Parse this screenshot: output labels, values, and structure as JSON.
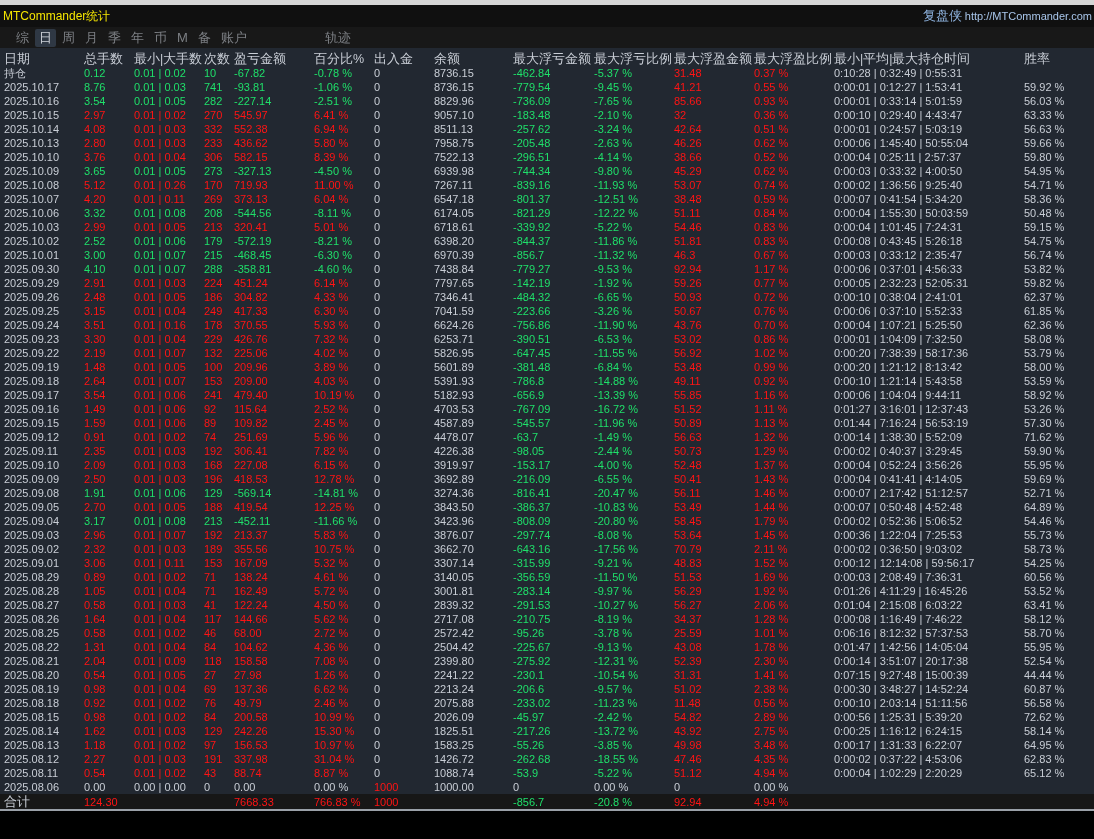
{
  "title": "MTCommander统计",
  "brand": {
    "name": "复盘侠",
    "link": "http://MTCommander.com"
  },
  "tabs": [
    {
      "label": "综",
      "selected": false
    },
    {
      "label": "日",
      "selected": true
    },
    {
      "label": "周",
      "selected": false
    },
    {
      "label": "月",
      "selected": false
    },
    {
      "label": "季",
      "selected": false
    },
    {
      "label": "年",
      "selected": false
    },
    {
      "label": "币",
      "selected": false
    },
    {
      "label": "M",
      "selected": false
    },
    {
      "label": "备",
      "selected": false
    },
    {
      "label": "账户",
      "selected": false
    }
  ],
  "extra_tabs": [
    {
      "label": "轨迹",
      "selected": false
    }
  ],
  "table": {
    "columns": [
      "日期",
      "总手数",
      "最小|大手数",
      "次数",
      "盈亏金额",
      "百分比%",
      "出入金",
      "余额",
      "最大浮亏金额",
      "最大浮亏比例",
      "最大浮盈金额",
      "最大浮盈比例",
      "最小|平均|最大持仓时间",
      "胜率"
    ],
    "rows": [
      {
        "kind": "loss",
        "cells": [
          "持仓",
          "0.12",
          "0.01 | 0.02",
          "10",
          "-67.82",
          "-0.78 %",
          "0",
          "8736.15",
          "-462.84",
          "-5.37 %",
          "31.48",
          "0.37 %",
          "0:10:28 | 0:32:49 | 0:55:31"
        ]
      },
      {
        "kind": "loss",
        "cells": [
          "2025.10.17",
          "8.76",
          "0.01 | 0.03",
          "741",
          "-93.81",
          "-1.06 %",
          "0",
          "8736.15",
          "-779.54",
          "-9.45 %",
          "41.21",
          "0.55 %",
          "0:00:01 | 0:12:27 | 1:53:41",
          "59.92 %"
        ]
      },
      {
        "kind": "loss",
        "cells": [
          "2025.10.16",
          "3.54",
          "0.01 | 0.05",
          "282",
          "-227.14",
          "-2.51 %",
          "0",
          "8829.96",
          "-736.09",
          "-7.65 %",
          "85.66",
          "0.93 %",
          "0:00:01 | 0:33:14 | 5:01:59",
          "56.03 %"
        ]
      },
      {
        "kind": "profit",
        "cells": [
          "2025.10.15",
          "2.97",
          "0.01 | 0.02",
          "270",
          "545.97",
          "6.41 %",
          "0",
          "9057.10",
          "-183.48",
          "-2.10 %",
          "32",
          "0.36 %",
          "0:00:10 | 0:29:40 | 4:43:47",
          "63.33 %"
        ]
      },
      {
        "kind": "profit",
        "cells": [
          "2025.10.14",
          "4.08",
          "0.01 | 0.03",
          "332",
          "552.38",
          "6.94 %",
          "0",
          "8511.13",
          "-257.62",
          "-3.24 %",
          "42.64",
          "0.51 %",
          "0:00:01 | 0:24:57 | 5:03:19",
          "56.63 %"
        ]
      },
      {
        "kind": "profit",
        "cells": [
          "2025.10.13",
          "2.80",
          "0.01 | 0.03",
          "233",
          "436.62",
          "5.80 %",
          "0",
          "7958.75",
          "-205.48",
          "-2.63 %",
          "46.26",
          "0.62 %",
          "0:00:06 | 1:45:40 | 50:55:04",
          "59.66 %"
        ]
      },
      {
        "kind": "profit",
        "cells": [
          "2025.10.10",
          "3.76",
          "0.01 | 0.04",
          "306",
          "582.15",
          "8.39 %",
          "0",
          "7522.13",
          "-296.51",
          "-4.14 %",
          "38.66",
          "0.52 %",
          "0:00:04 | 0:25:11 | 2:57:37",
          "59.80 %"
        ]
      },
      {
        "kind": "loss",
        "cells": [
          "2025.10.09",
          "3.65",
          "0.01 | 0.05",
          "273",
          "-327.13",
          "-4.50 %",
          "0",
          "6939.98",
          "-744.34",
          "-9.80 %",
          "45.29",
          "0.62 %",
          "0:00:03 | 0:33:32 | 4:00:50",
          "54.95 %"
        ]
      },
      {
        "kind": "profit",
        "cells": [
          "2025.10.08",
          "5.12",
          "0.01 | 0.26",
          "170",
          "719.93",
          "11.00 %",
          "0",
          "7267.11",
          "-839.16",
          "-11.93 %",
          "53.07",
          "0.74 %",
          "0:00:02 | 1:36:56 | 9:25:40",
          "54.71 %"
        ]
      },
      {
        "kind": "profit",
        "cells": [
          "2025.10.07",
          "4.20",
          "0.01 | 0.11",
          "269",
          "373.13",
          "6.04 %",
          "0",
          "6547.18",
          "-801.37",
          "-12.51 %",
          "38.48",
          "0.59 %",
          "0:00:07 | 0:41:54 | 5:34:20",
          "58.36 %"
        ]
      },
      {
        "kind": "loss",
        "cells": [
          "2025.10.06",
          "3.32",
          "0.01 | 0.08",
          "208",
          "-544.56",
          "-8.11 %",
          "0",
          "6174.05",
          "-821.29",
          "-12.22 %",
          "51.11",
          "0.84 %",
          "0:00:04 | 1:55:30 | 50:03:59",
          "50.48 %"
        ]
      },
      {
        "kind": "profit",
        "cells": [
          "2025.10.03",
          "2.99",
          "0.01 | 0.05",
          "213",
          "320.41",
          "5.01 %",
          "0",
          "6718.61",
          "-339.92",
          "-5.22 %",
          "54.46",
          "0.83 %",
          "0:00:04 | 1:01:45 | 7:24:31",
          "59.15 %"
        ]
      },
      {
        "kind": "loss",
        "cells": [
          "2025.10.02",
          "2.52",
          "0.01 | 0.06",
          "179",
          "-572.19",
          "-8.21 %",
          "0",
          "6398.20",
          "-844.37",
          "-11.86 %",
          "51.81",
          "0.83 %",
          "0:00:08 | 0:43:45 | 5:26:18",
          "54.75 %"
        ]
      },
      {
        "kind": "loss",
        "cells": [
          "2025.10.01",
          "3.00",
          "0.01 | 0.07",
          "215",
          "-468.45",
          "-6.30 %",
          "0",
          "6970.39",
          "-856.7",
          "-11.32 %",
          "46.3",
          "0.67 %",
          "0:00:03 | 0:33:12 | 2:35:47",
          "56.74 %"
        ]
      },
      {
        "kind": "loss",
        "cells": [
          "2025.09.30",
          "4.10",
          "0.01 | 0.07",
          "288",
          "-358.81",
          "-4.60 %",
          "0",
          "7438.84",
          "-779.27",
          "-9.53 %",
          "92.94",
          "1.17 %",
          "0:00:06 | 0:37:01 | 4:56:33",
          "53.82 %"
        ]
      },
      {
        "kind": "profit",
        "cells": [
          "2025.09.29",
          "2.91",
          "0.01 | 0.03",
          "224",
          "451.24",
          "6.14 %",
          "0",
          "7797.65",
          "-142.19",
          "-1.92 %",
          "59.26",
          "0.77 %",
          "0:00:05 | 2:32:23 | 52:05:31",
          "59.82 %"
        ]
      },
      {
        "kind": "profit",
        "cells": [
          "2025.09.26",
          "2.48",
          "0.01 | 0.05",
          "186",
          "304.82",
          "4.33 %",
          "0",
          "7346.41",
          "-484.32",
          "-6.65 %",
          "50.93",
          "0.72 %",
          "0:00:10 | 0:38:04 | 2:41:01",
          "62.37 %"
        ]
      },
      {
        "kind": "profit",
        "cells": [
          "2025.09.25",
          "3.15",
          "0.01 | 0.04",
          "249",
          "417.33",
          "6.30 %",
          "0",
          "7041.59",
          "-223.66",
          "-3.26 %",
          "50.67",
          "0.76 %",
          "0:00:06 | 0:37:10 | 5:52:33",
          "61.85 %"
        ]
      },
      {
        "kind": "profit",
        "cells": [
          "2025.09.24",
          "3.51",
          "0.01 | 0.16",
          "178",
          "370.55",
          "5.93 %",
          "0",
          "6624.26",
          "-756.86",
          "-11.90 %",
          "43.76",
          "0.70 %",
          "0:00:04 | 1:07:21 | 5:25:50",
          "62.36 %"
        ]
      },
      {
        "kind": "profit",
        "cells": [
          "2025.09.23",
          "3.30",
          "0.01 | 0.04",
          "229",
          "426.76",
          "7.32 %",
          "0",
          "6253.71",
          "-390.51",
          "-6.53 %",
          "53.02",
          "0.86 %",
          "0:00:01 | 1:04:09 | 7:32:50",
          "58.08 %"
        ]
      },
      {
        "kind": "profit",
        "cells": [
          "2025.09.22",
          "2.19",
          "0.01 | 0.07",
          "132",
          "225.06",
          "4.02 %",
          "0",
          "5826.95",
          "-647.45",
          "-11.55 %",
          "56.92",
          "1.02 %",
          "0:00:20 | 7:38:39 | 58:17:36",
          "53.79 %"
        ]
      },
      {
        "kind": "profit",
        "cells": [
          "2025.09.19",
          "1.48",
          "0.01 | 0.05",
          "100",
          "209.96",
          "3.89 %",
          "0",
          "5601.89",
          "-381.48",
          "-6.84 %",
          "53.48",
          "0.99 %",
          "0:00:20 | 1:21:12 | 8:13:42",
          "58.00 %"
        ]
      },
      {
        "kind": "profit",
        "cells": [
          "2025.09.18",
          "2.64",
          "0.01 | 0.07",
          "153",
          "209.00",
          "4.03 %",
          "0",
          "5391.93",
          "-786.8",
          "-14.88 %",
          "49.11",
          "0.92 %",
          "0:00:10 | 1:21:14 | 5:43:58",
          "53.59 %"
        ]
      },
      {
        "kind": "profit",
        "cells": [
          "2025.09.17",
          "3.54",
          "0.01 | 0.06",
          "241",
          "479.40",
          "10.19 %",
          "0",
          "5182.93",
          "-656.9",
          "-13.39 %",
          "55.85",
          "1.16 %",
          "0:00:06 | 1:04:04 | 9:44:11",
          "58.92 %"
        ]
      },
      {
        "kind": "profit",
        "cells": [
          "2025.09.16",
          "1.49",
          "0.01 | 0.06",
          "92",
          "115.64",
          "2.52 %",
          "0",
          "4703.53",
          "-767.09",
          "-16.72 %",
          "51.52",
          "1.11 %",
          "0:01:27 | 3:16:01 | 12:37:43",
          "53.26 %"
        ]
      },
      {
        "kind": "profit",
        "cells": [
          "2025.09.15",
          "1.59",
          "0.01 | 0.06",
          "89",
          "109.82",
          "2.45 %",
          "0",
          "4587.89",
          "-545.57",
          "-11.96 %",
          "50.89",
          "1.13 %",
          "0:01:44 | 7:16:24 | 56:53:19",
          "57.30 %"
        ]
      },
      {
        "kind": "profit",
        "cells": [
          "2025.09.12",
          "0.91",
          "0.01 | 0.02",
          "74",
          "251.69",
          "5.96 %",
          "0",
          "4478.07",
          "-63.7",
          "-1.49 %",
          "56.63",
          "1.32 %",
          "0:00:14 | 1:38:30 | 5:52:09",
          "71.62 %"
        ]
      },
      {
        "kind": "profit",
        "cells": [
          "2025.09.11",
          "2.35",
          "0.01 | 0.03",
          "192",
          "306.41",
          "7.82 %",
          "0",
          "4226.38",
          "-98.05",
          "-2.44 %",
          "50.73",
          "1.29 %",
          "0:00:02 | 0:40:37 | 3:29:45",
          "59.90 %"
        ]
      },
      {
        "kind": "profit",
        "cells": [
          "2025.09.10",
          "2.09",
          "0.01 | 0.03",
          "168",
          "227.08",
          "6.15 %",
          "0",
          "3919.97",
          "-153.17",
          "-4.00 %",
          "52.48",
          "1.37 %",
          "0:00:04 | 0:52:24 | 3:56:26",
          "55.95 %"
        ]
      },
      {
        "kind": "profit",
        "cells": [
          "2025.09.09",
          "2.50",
          "0.01 | 0.03",
          "196",
          "418.53",
          "12.78 %",
          "0",
          "3692.89",
          "-216.09",
          "-6.55 %",
          "50.41",
          "1.43 %",
          "0:00:04 | 0:41:41 | 4:14:05",
          "59.69 %"
        ]
      },
      {
        "kind": "loss",
        "cells": [
          "2025.09.08",
          "1.91",
          "0.01 | 0.06",
          "129",
          "-569.14",
          "-14.81 %",
          "0",
          "3274.36",
          "-816.41",
          "-20.47 %",
          "56.11",
          "1.46 %",
          "0:00:07 | 2:17:42 | 51:12:57",
          "52.71 %"
        ]
      },
      {
        "kind": "profit",
        "cells": [
          "2025.09.05",
          "2.70",
          "0.01 | 0.05",
          "188",
          "419.54",
          "12.25 %",
          "0",
          "3843.50",
          "-386.37",
          "-10.83 %",
          "53.49",
          "1.44 %",
          "0:00:07 | 0:50:48 | 4:52:48",
          "64.89 %"
        ]
      },
      {
        "kind": "loss",
        "cells": [
          "2025.09.04",
          "3.17",
          "0.01 | 0.08",
          "213",
          "-452.11",
          "-11.66 %",
          "0",
          "3423.96",
          "-808.09",
          "-20.80 %",
          "58.45",
          "1.79 %",
          "0:00:02 | 0:52:36 | 5:06:52",
          "54.46 %"
        ]
      },
      {
        "kind": "profit",
        "cells": [
          "2025.09.03",
          "2.96",
          "0.01 | 0.07",
          "192",
          "213.37",
          "5.83 %",
          "0",
          "3876.07",
          "-297.74",
          "-8.08 %",
          "53.64",
          "1.45 %",
          "0:00:36 | 1:22:04 | 7:25:53",
          "55.73 %"
        ]
      },
      {
        "kind": "profit",
        "cells": [
          "2025.09.02",
          "2.32",
          "0.01 | 0.03",
          "189",
          "355.56",
          "10.75 %",
          "0",
          "3662.70",
          "-643.16",
          "-17.56 %",
          "70.79",
          "2.11 %",
          "0:00:02 | 0:36:50 | 9:03:02",
          "58.73 %"
        ]
      },
      {
        "kind": "profit",
        "cells": [
          "2025.09.01",
          "3.06",
          "0.01 | 0.11",
          "153",
          "167.09",
          "5.32 %",
          "0",
          "3307.14",
          "-315.99",
          "-9.21 %",
          "48.83",
          "1.52 %",
          "0:00:12 | 12:14:08 | 59:56:17",
          "54.25 %"
        ]
      },
      {
        "kind": "profit",
        "cells": [
          "2025.08.29",
          "0.89",
          "0.01 | 0.02",
          "71",
          "138.24",
          "4.61 %",
          "0",
          "3140.05",
          "-356.59",
          "-11.50 %",
          "51.53",
          "1.69 %",
          "0:00:03 | 2:08:49 | 7:36:31",
          "60.56 %"
        ]
      },
      {
        "kind": "profit",
        "cells": [
          "2025.08.28",
          "1.05",
          "0.01 | 0.04",
          "71",
          "162.49",
          "5.72 %",
          "0",
          "3001.81",
          "-283.14",
          "-9.97 %",
          "56.29",
          "1.92 %",
          "0:01:26 | 4:11:29 | 16:45:26",
          "53.52 %"
        ]
      },
      {
        "kind": "profit",
        "cells": [
          "2025.08.27",
          "0.58",
          "0.01 | 0.03",
          "41",
          "122.24",
          "4.50 %",
          "0",
          "2839.32",
          "-291.53",
          "-10.27 %",
          "56.27",
          "2.06 %",
          "0:01:04 | 2:15:08 | 6:03:22",
          "63.41 %"
        ]
      },
      {
        "kind": "profit",
        "cells": [
          "2025.08.26",
          "1.64",
          "0.01 | 0.04",
          "117",
          "144.66",
          "5.62 %",
          "0",
          "2717.08",
          "-210.75",
          "-8.19 %",
          "34.37",
          "1.28 %",
          "0:00:08 | 1:16:49 | 7:46:22",
          "58.12 %"
        ]
      },
      {
        "kind": "profit",
        "cells": [
          "2025.08.25",
          "0.58",
          "0.01 | 0.02",
          "46",
          "68.00",
          "2.72 %",
          "0",
          "2572.42",
          "-95.26",
          "-3.78 %",
          "25.59",
          "1.01 %",
          "0:06:16 | 8:12:32 | 57:37:53",
          "58.70 %"
        ]
      },
      {
        "kind": "profit",
        "cells": [
          "2025.08.22",
          "1.31",
          "0.01 | 0.04",
          "84",
          "104.62",
          "4.36 %",
          "0",
          "2504.42",
          "-225.67",
          "-9.13 %",
          "43.08",
          "1.78 %",
          "0:01:47 | 1:42:56 | 14:05:04",
          "55.95 %"
        ]
      },
      {
        "kind": "profit",
        "cells": [
          "2025.08.21",
          "2.04",
          "0.01 | 0.09",
          "118",
          "158.58",
          "7.08 %",
          "0",
          "2399.80",
          "-275.92",
          "-12.31 %",
          "52.39",
          "2.30 %",
          "0:00:14 | 3:51:07 | 20:17:38",
          "52.54 %"
        ]
      },
      {
        "kind": "profit",
        "cells": [
          "2025.08.20",
          "0.54",
          "0.01 | 0.05",
          "27",
          "27.98",
          "1.26 %",
          "0",
          "2241.22",
          "-230.1",
          "-10.54 %",
          "31.31",
          "1.41 %",
          "0:07:15 | 9:27:48 | 15:00:39",
          "44.44 %"
        ]
      },
      {
        "kind": "profit",
        "cells": [
          "2025.08.19",
          "0.98",
          "0.01 | 0.04",
          "69",
          "137.36",
          "6.62 %",
          "0",
          "2213.24",
          "-206.6",
          "-9.57 %",
          "51.02",
          "2.38 %",
          "0:00:30 | 3:48:27 | 14:52:24",
          "60.87 %"
        ]
      },
      {
        "kind": "profit",
        "cells": [
          "2025.08.18",
          "0.92",
          "0.01 | 0.02",
          "76",
          "49.79",
          "2.46 %",
          "0",
          "2075.88",
          "-233.02",
          "-11.23 %",
          "11.48",
          "0.56 %",
          "0:00:10 | 2:03:14 | 51:11:56",
          "56.58 %"
        ]
      },
      {
        "kind": "profit",
        "cells": [
          "2025.08.15",
          "0.98",
          "0.01 | 0.02",
          "84",
          "200.58",
          "10.99 %",
          "0",
          "2026.09",
          "-45.97",
          "-2.42 %",
          "54.82",
          "2.89 %",
          "0:00:56 | 1:25:31 | 5:39:20",
          "72.62 %"
        ]
      },
      {
        "kind": "profit",
        "cells": [
          "2025.08.14",
          "1.62",
          "0.01 | 0.03",
          "129",
          "242.26",
          "15.30 %",
          "0",
          "1825.51",
          "-217.26",
          "-13.72 %",
          "43.92",
          "2.75 %",
          "0:00:25 | 1:16:12 | 6:24:15",
          "58.14 %"
        ]
      },
      {
        "kind": "profit",
        "cells": [
          "2025.08.13",
          "1.18",
          "0.01 | 0.02",
          "97",
          "156.53",
          "10.97 %",
          "0",
          "1583.25",
          "-55.26",
          "-3.85 %",
          "49.98",
          "3.48 %",
          "0:00:17 | 1:31:33 | 6:22:07",
          "64.95 %"
        ]
      },
      {
        "kind": "profit",
        "cells": [
          "2025.08.12",
          "2.27",
          "0.01 | 0.03",
          "191",
          "337.98",
          "31.04 %",
          "0",
          "1426.72",
          "-262.68",
          "-18.55 %",
          "47.46",
          "4.35 %",
          "0:00:02 | 0:37:22 | 4:53:06",
          "62.83 %"
        ]
      },
      {
        "kind": "profit",
        "cells": [
          "2025.08.11",
          "0.54",
          "0.01 | 0.02",
          "43",
          "88.74",
          "8.87 %",
          "0",
          "1088.74",
          "-53.9",
          "-5.22 %",
          "51.12",
          "4.94 %",
          "0:00:04 | 1:02:29 | 2:20:29",
          "65.12 %"
        ]
      },
      {
        "kind": "flat",
        "deposit": true,
        "cells": [
          "2025.08.06",
          "0.00",
          "0.00 | 0.00",
          "0",
          "0.00",
          "0.00 %",
          "1000",
          "1000.00",
          "0",
          "0.00 %",
          "0",
          "0.00 %"
        ]
      }
    ],
    "totals": {
      "label": "合计",
      "kind": "profit",
      "deposit": true,
      "lots": "124.30",
      "pnl": "7668.33",
      "pct": "766.83 %",
      "flow": "1000",
      "max_dd": "-856.7",
      "max_dd_pct": "-20.8 %",
      "max_fp": "92.94",
      "max_fp_pct": "4.94 %"
    }
  }
}
